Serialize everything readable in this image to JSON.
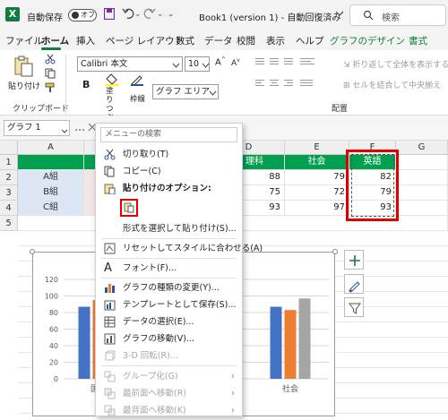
{
  "titlebar": {
    "autosave_label": "自動保存",
    "autosave_state": "オフ",
    "document_title": "Book1 (version 1)  -  自動回復済み",
    "dropdown_glyph": "⌄",
    "search_placeholder": "検索"
  },
  "tabs": [
    "ファイル",
    "ホーム",
    "挿入",
    "ページ レイアウト",
    "数式",
    "データ",
    "校閲",
    "表示",
    "ヘルプ",
    "グラフのデザイン",
    "書式"
  ],
  "ribbon": {
    "paste_label": "貼り付け",
    "clipboard_group": "クリップボード",
    "font_name": "Calibri 本文",
    "font_size": "10",
    "bold": "B",
    "fill_label": "塗りつぶし",
    "border_label": "枠線",
    "chart_element": "グラフ エリア",
    "wrap_text": "折り返して全体を表示する",
    "merge_center": "セルを結合して中央揃え",
    "align_group": "配置"
  },
  "formula_bar": {
    "name_box": "グラフ 1"
  },
  "columns": [
    "A",
    "D",
    "E",
    "F",
    "G"
  ],
  "rows": [
    "1",
    "2",
    "3",
    "4",
    "5"
  ],
  "sheet": {
    "col_headers": {
      "D": "理科",
      "E": "社会",
      "F": "英語"
    },
    "names": [
      "A組",
      "B組",
      "C組"
    ],
    "D": [
      "88",
      "75",
      "93"
    ],
    "E": [
      "79",
      "72",
      "97"
    ],
    "F": [
      "82",
      "79",
      "93"
    ]
  },
  "context_menu": {
    "search_placeholder": "メニューの検索",
    "cut": "切り取り(T)",
    "copy": "コピー(C)",
    "paste_options": "貼り付けのオプション:",
    "paste_special": "形式を選択して貼り付け(S)...",
    "reset_style": "リセットしてスタイルに合わせる(A)",
    "font": "フォント(F)...",
    "change_chart_type": "グラフの種類の変更(Y)...",
    "save_template": "テンプレートとして保存(S)...",
    "select_data": "データの選択(E)...",
    "move_chart": "グラフの移動(V)...",
    "rotate_3d": "3-D 回転(R)...",
    "group": "グループ化(G)",
    "bring_forward": "最前面へ移動(R)",
    "send_backward": "最背面へ移動(K)"
  },
  "chart_data": {
    "type": "bar",
    "categories": [
      "国語",
      "",
      "社会"
    ],
    "series": [
      {
        "values": [
          87,
          null,
          87
        ]
      },
      {
        "values": [
          95,
          null,
          83
        ]
      },
      {
        "values": [
          null,
          null,
          97
        ]
      }
    ],
    "ylim": [
      0,
      120
    ],
    "yticks": [
      "120",
      "100",
      "80",
      "60",
      "40",
      "20",
      "0"
    ],
    "colors": [
      "#4472c4",
      "#ed7d31",
      "#a5a5a5"
    ]
  },
  "colors": {
    "excel_green": "#107c41",
    "header_green": "#00a050",
    "highlight_red": "#e00000"
  }
}
